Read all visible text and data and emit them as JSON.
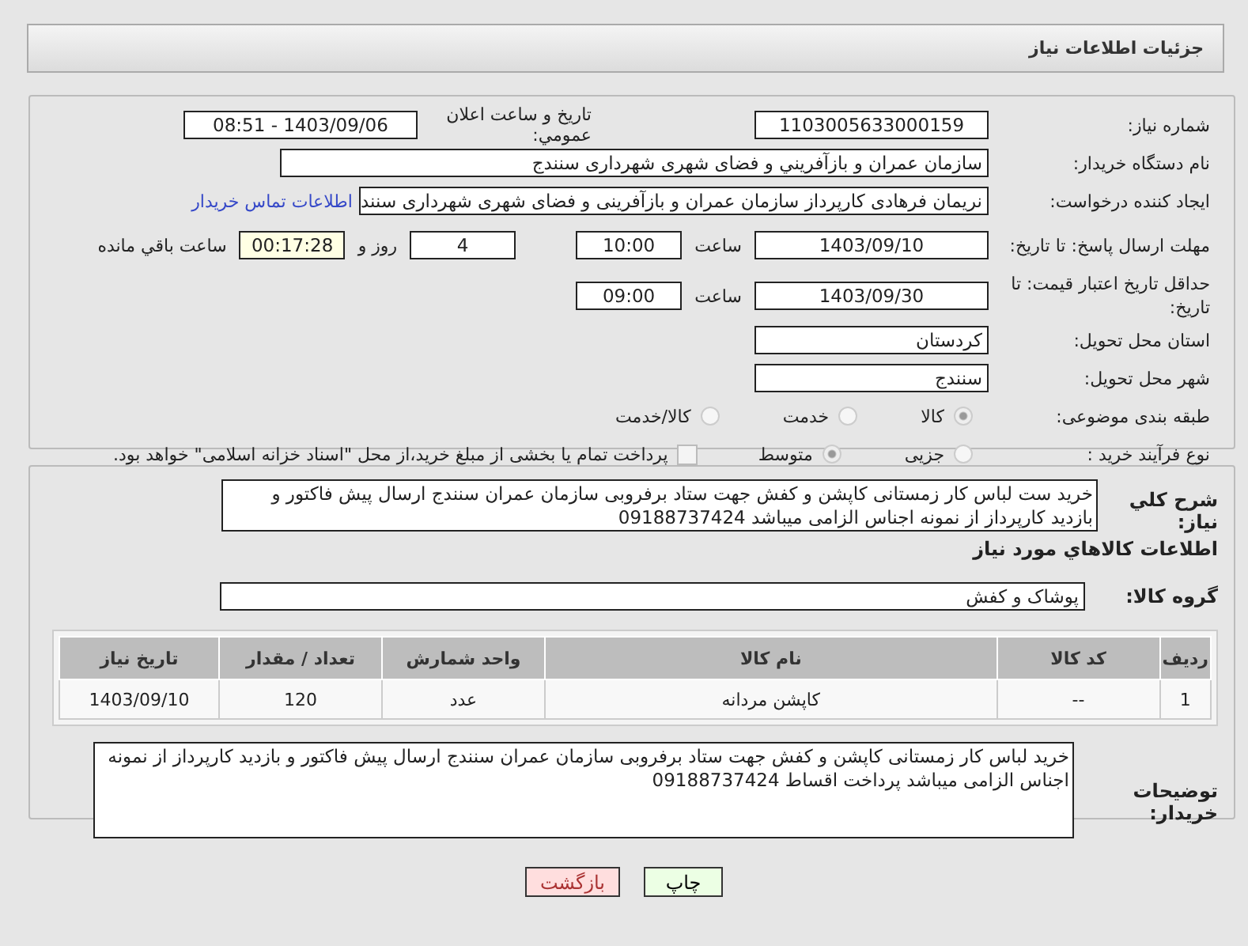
{
  "header": {
    "title": "جزئيات اطلاعات نياز"
  },
  "need_number": {
    "label": "شماره نیاز:",
    "value": "1103005633000159"
  },
  "announce": {
    "label": "تاریخ و ساعت اعلان عمومي:",
    "value": "1403/09/06 - 08:51"
  },
  "buyer": {
    "label": "نام دستگاه خریدار:",
    "value": "سازمان عمران و بازآفريني و فضای شهری شهرداری سنندج"
  },
  "creator": {
    "label": "ایجاد کننده درخواست:",
    "value": "نریمان فرهادی کارپرداز سازمان عمران و بازآفرینی و فضای شهری شهرداری سنند",
    "link": "اطلاعات تماس خریدار"
  },
  "deadline": {
    "label": "مهلت ارسال پاسخ: تا تاریخ:",
    "date": "1403/09/10",
    "time_label": "ساعت",
    "time": "10:00",
    "days": "4",
    "days_label": "روز و",
    "remaining": "00:17:28",
    "remaining_label": "ساعت باقي مانده"
  },
  "validity": {
    "label": "حداقل تاریخ اعتبار قیمت: تا تاریخ:",
    "date": "1403/09/30",
    "time_label": "ساعت",
    "time": "09:00"
  },
  "province": {
    "label": "استان محل تحویل:",
    "value": "کردستان"
  },
  "city": {
    "label": "شهر محل تحویل:",
    "value": "سنندج"
  },
  "category": {
    "label": "طبقه بندی موضوعی:",
    "options": [
      {
        "label": "کالا",
        "selected": true
      },
      {
        "label": "خدمت",
        "selected": false
      },
      {
        "label": "کالا/خدمت",
        "selected": false
      }
    ]
  },
  "process": {
    "label": "نوع فرآیند خرید :",
    "options": [
      {
        "label": "جزیی",
        "selected": false
      },
      {
        "label": "متوسط",
        "selected": true
      }
    ],
    "payment": {
      "checked": false,
      "text": "پرداخت تمام یا بخشی از مبلغ خرید،از محل \"اسناد خزانه اسلامی\" خواهد بود."
    }
  },
  "description": {
    "label": "شرح کلي نياز:",
    "value": "خرید ست لباس کار زمستانی کاپشن و کفش جهت ستاد برفروبی سازمان عمران سنندج ارسال پیش فاکتور و بازدید کارپرداز از نمونه اجناس الزامی میباشد 09188737424"
  },
  "goods_heading": "اطلاعات کالاهاي مورد نياز",
  "goods_group": {
    "label": "گروه کالا:",
    "value": "پوشاک و کفش"
  },
  "table": {
    "columns": [
      "رديف",
      "کد کالا",
      "نام کالا",
      "واحد شمارش",
      "تعداد / مقدار",
      "تاريخ نياز"
    ],
    "rows": [
      [
        "1",
        "--",
        "کاپشن مردانه",
        "عدد",
        "120",
        "1403/09/10"
      ]
    ]
  },
  "buyer_notes": {
    "label": "توضیحات خریدار:",
    "value": "خرید لباس کار زمستانی کاپشن و کفش جهت ستاد برفروبی سازمان عمران سنندج ارسال پیش فاکتور و بازدید کارپرداز از نمونه اجناس الزامی میباشد  پرداخت اقساط 09188737424"
  },
  "buttons": [
    {
      "label": "چاپ",
      "kind": "print"
    },
    {
      "label": "بازگشت",
      "kind": "back"
    }
  ]
}
